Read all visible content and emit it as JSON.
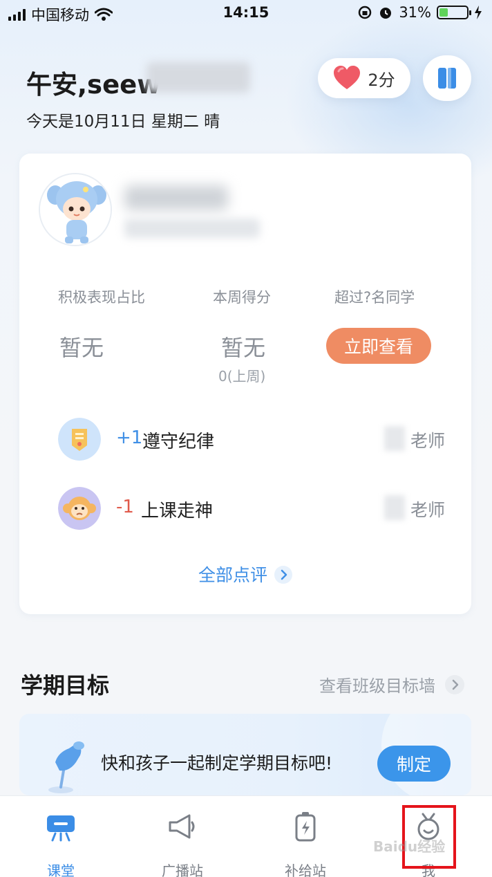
{
  "status_bar": {
    "carrier": "中国移动",
    "time": "14:15",
    "battery_percent": "31%",
    "battery_level": 0.31
  },
  "header": {
    "greeting": "午安,seew",
    "date_line": "今天是10月11日 星期二 晴",
    "heart_points": "2分"
  },
  "card": {
    "stats": {
      "labels": [
        "积极表现占比",
        "本周得分",
        "超过?名同学"
      ],
      "values": [
        "暂无",
        "暂无"
      ],
      "last_week": "0(上周)",
      "view_button": "立即查看"
    },
    "records": [
      {
        "score": "+1",
        "text": "遵守纪律",
        "teacher": "老师",
        "score_color": "#3f8fe6"
      },
      {
        "score": "-1",
        "text": "上课走神",
        "teacher": "老师",
        "score_color": "#e05a4b"
      }
    ],
    "all_reviews": "全部点评"
  },
  "goals": {
    "title": "学期目标",
    "link": "查看班级目标墙",
    "prompt": "快和孩子一起制定学期目标吧!",
    "button": "制定"
  },
  "tabbar": {
    "tabs": [
      {
        "label": "课堂",
        "icon": "classroom-icon",
        "active": true
      },
      {
        "label": "广播站",
        "icon": "megaphone-icon",
        "active": false
      },
      {
        "label": "补给站",
        "icon": "battery-charge-icon",
        "active": false
      },
      {
        "label": "我",
        "icon": "profile-icon",
        "active": false
      }
    ]
  },
  "watermark": "Baidu经验"
}
